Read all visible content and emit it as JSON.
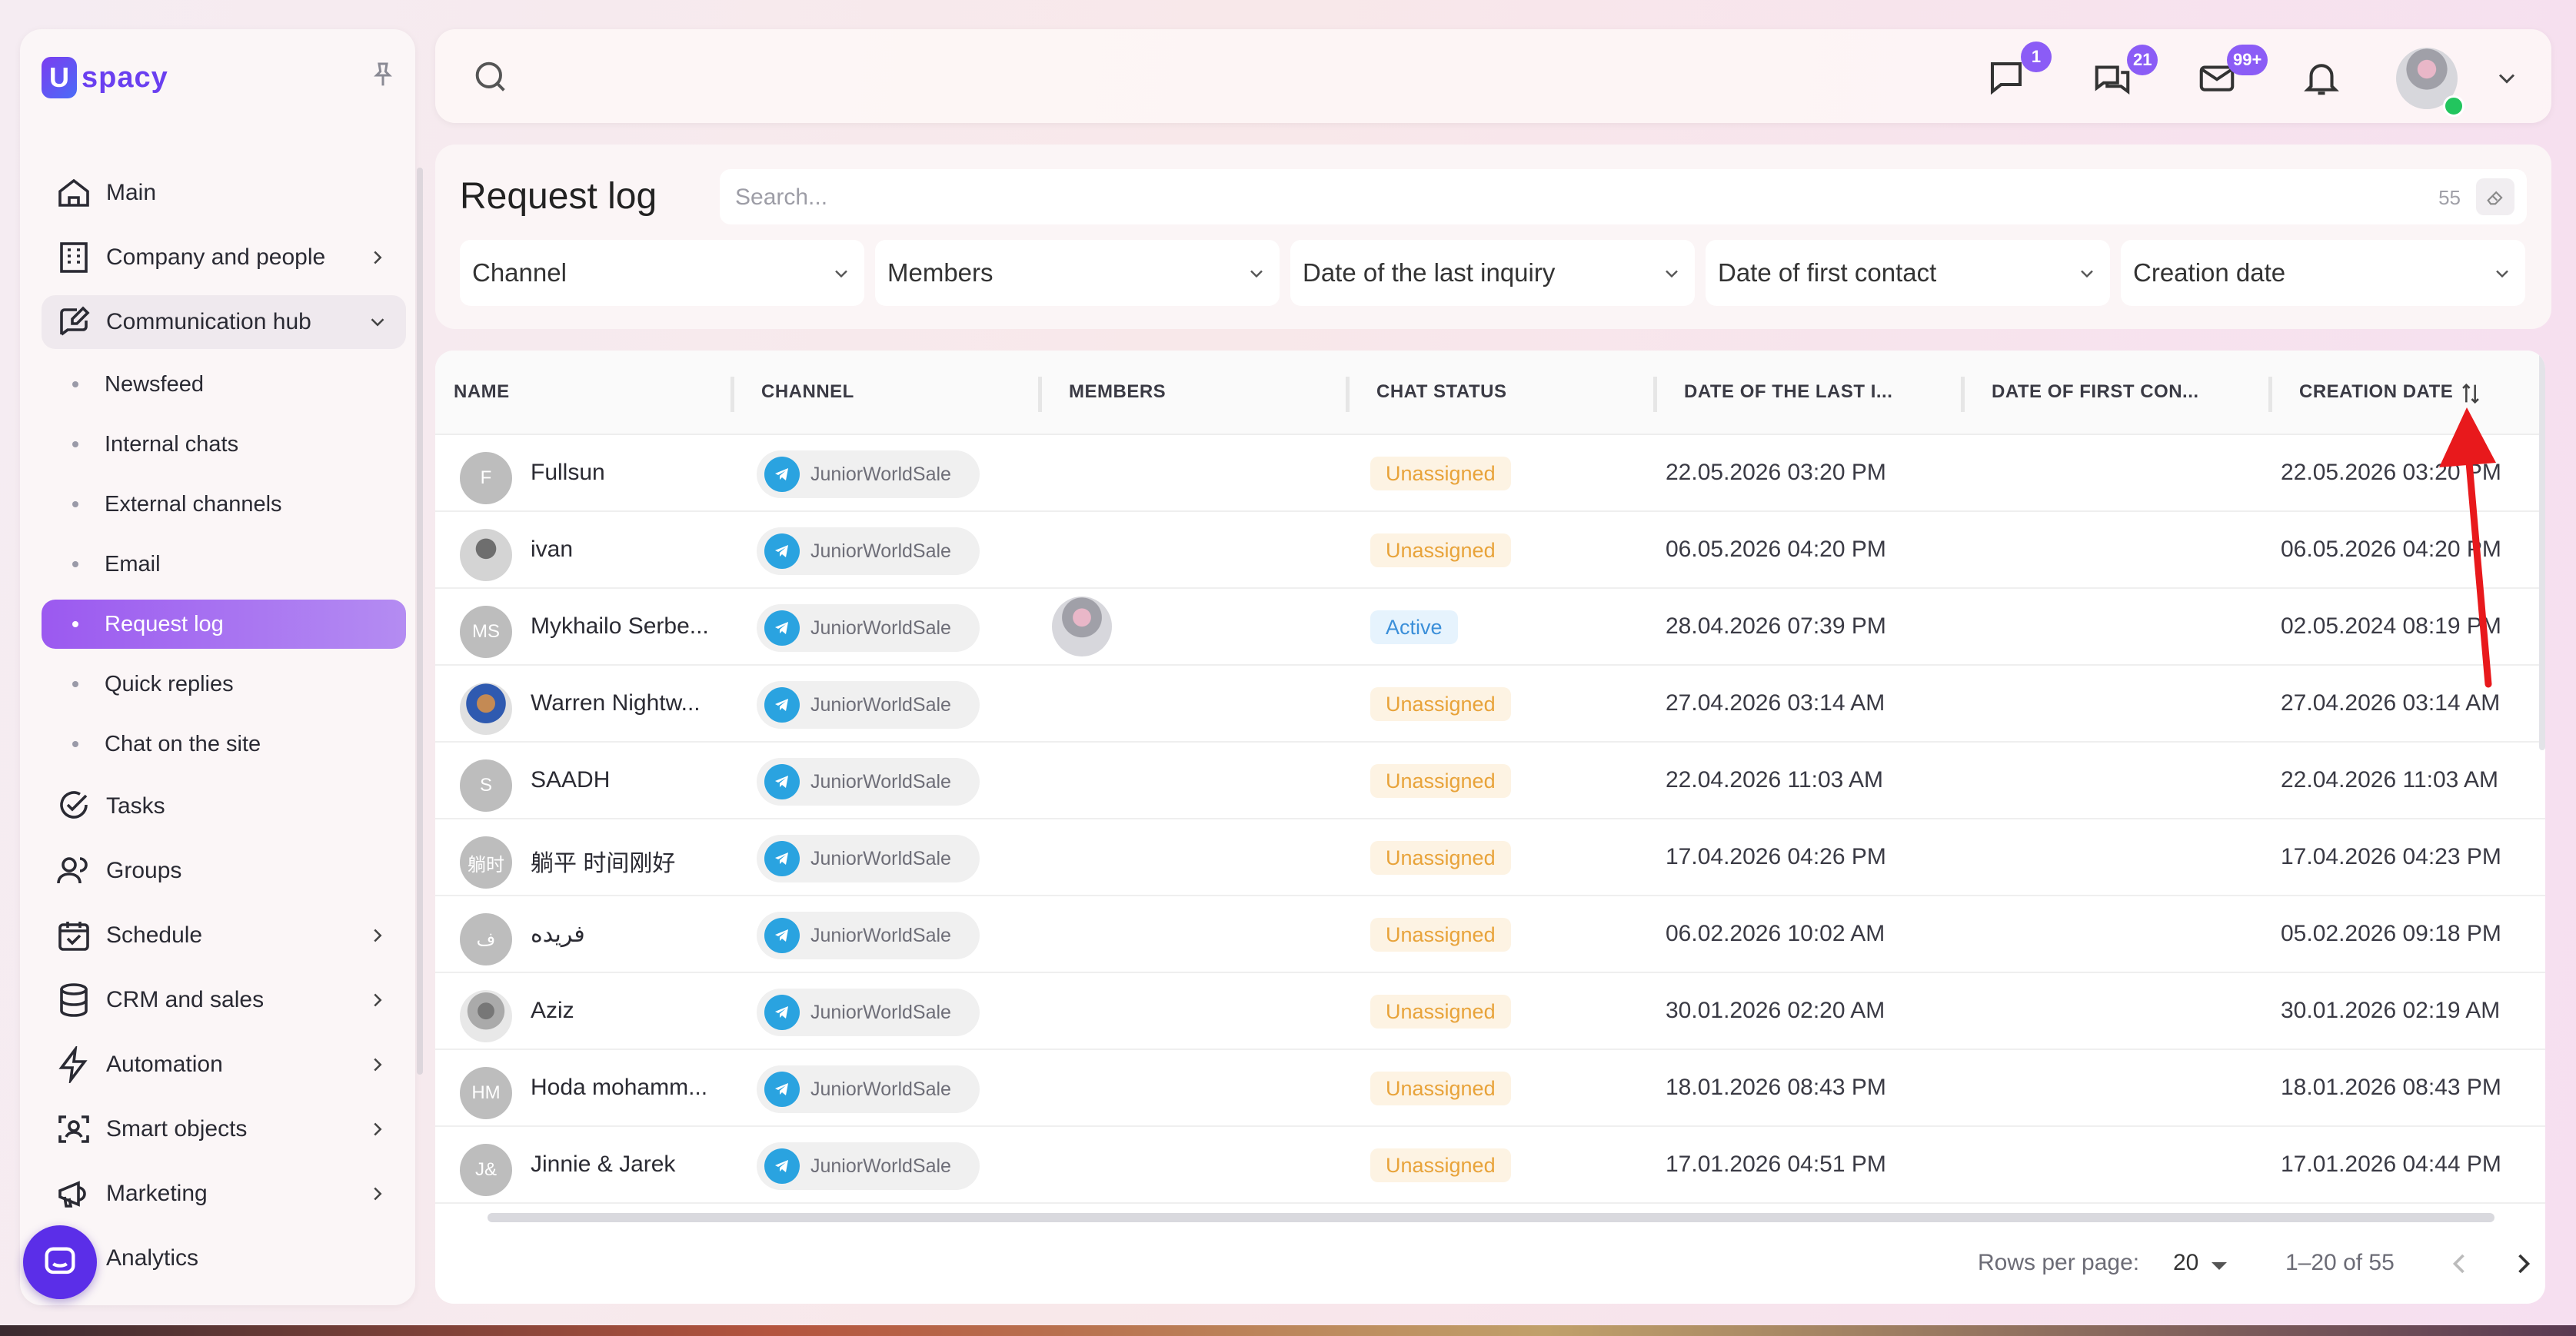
{
  "app": {
    "logo_text": "spacy",
    "logo_letter": "U"
  },
  "sidebar": {
    "items": [
      {
        "label": "Main",
        "icon": "home-icon"
      },
      {
        "label": "Company and people",
        "icon": "building-icon",
        "chevron": "right"
      },
      {
        "label": "Communication hub",
        "icon": "chat-edit-icon",
        "chevron": "down",
        "open": true
      },
      {
        "label": "Tasks",
        "icon": "check-circle-icon"
      },
      {
        "label": "Groups",
        "icon": "users-icon"
      },
      {
        "label": "Schedule",
        "icon": "calendar-icon",
        "chevron": "right"
      },
      {
        "label": "CRM and sales",
        "icon": "database-icon",
        "chevron": "right"
      },
      {
        "label": "Automation",
        "icon": "lightning-icon",
        "chevron": "right"
      },
      {
        "label": "Smart objects",
        "icon": "scan-face-icon",
        "chevron": "right"
      },
      {
        "label": "Marketing",
        "icon": "megaphone-icon",
        "chevron": "right"
      },
      {
        "label": "Analytics",
        "icon": "chart-icon"
      }
    ],
    "sub_items": [
      {
        "label": "Newsfeed"
      },
      {
        "label": "Internal chats"
      },
      {
        "label": "External channels"
      },
      {
        "label": "Email"
      },
      {
        "label": "Request log",
        "active": true
      },
      {
        "label": "Quick replies"
      },
      {
        "label": "Chat on the site"
      }
    ]
  },
  "topbar": {
    "badges": {
      "chat": "1",
      "messages": "21",
      "mail": "99+"
    }
  },
  "page": {
    "title": "Request log",
    "search_placeholder": "Search...",
    "search_count": "55",
    "filters": [
      "Channel",
      "Members",
      "Date of the last inquiry",
      "Date of first contact",
      "Creation date"
    ]
  },
  "table": {
    "columns": [
      "NAME",
      "CHANNEL",
      "MEMBERS",
      "CHAT STATUS",
      "DATE OF THE LAST I...",
      "DATE OF FIRST CON...",
      "CREATION DATE"
    ],
    "rows": [
      {
        "initials": "F",
        "name": "Fullsun",
        "channel": "JuniorWorldSale",
        "status": "Unassigned",
        "last": "22.05.2026 03:20 PM",
        "created": "22.05.2026 03:20 PM"
      },
      {
        "initials": "",
        "name": "ivan",
        "channel": "JuniorWorldSale",
        "status": "Unassigned",
        "last": "06.05.2026 04:20 PM",
        "created": "06.05.2026 04:20 PM"
      },
      {
        "initials": "MS",
        "name": "Mykhailo Serbe...",
        "channel": "JuniorWorldSale",
        "status": "Active",
        "last": "28.04.2026 07:39 PM",
        "created": "02.05.2024 08:19 PM"
      },
      {
        "initials": "",
        "name": "Warren Nightw...",
        "channel": "JuniorWorldSale",
        "status": "Unassigned",
        "last": "27.04.2026 03:14 AM",
        "created": "27.04.2026 03:14 AM"
      },
      {
        "initials": "S",
        "name": "SAADH",
        "channel": "JuniorWorldSale",
        "status": "Unassigned",
        "last": "22.04.2026 11:03 AM",
        "created": "22.04.2026 11:03 AM"
      },
      {
        "initials": "躺时",
        "name": "躺平 时间刚好",
        "channel": "JuniorWorldSale",
        "status": "Unassigned",
        "last": "17.04.2026 04:26 PM",
        "created": "17.04.2026 04:23 PM"
      },
      {
        "initials": "ف",
        "name": "فريده",
        "channel": "JuniorWorldSale",
        "status": "Unassigned",
        "last": "06.02.2026 10:02 AM",
        "created": "05.02.2026 09:18 PM"
      },
      {
        "initials": "",
        "name": "Aziz",
        "channel": "JuniorWorldSale",
        "status": "Unassigned",
        "last": "30.01.2026 02:20 AM",
        "created": "30.01.2026 02:19 AM"
      },
      {
        "initials": "HM",
        "name": "Hoda mohamm...",
        "channel": "JuniorWorldSale",
        "status": "Unassigned",
        "last": "18.01.2026 08:43 PM",
        "created": "18.01.2026 08:43 PM"
      },
      {
        "initials": "J&",
        "name": "Jinnie & Jarek",
        "channel": "JuniorWorldSale",
        "status": "Unassigned",
        "last": "17.01.2026 04:51 PM",
        "created": "17.01.2026 04:44 PM"
      }
    ]
  },
  "pagination": {
    "rows_label": "Rows per page:",
    "rows_value": "20",
    "range": "1–20 of 55"
  },
  "colors": {
    "accent": "#9b59f0",
    "brand": "#5b2ee8",
    "unassigned": "#e8a33a",
    "active": "#3b8fd9",
    "telegram": "#2aa3e0",
    "annotation": "#e8191c"
  }
}
